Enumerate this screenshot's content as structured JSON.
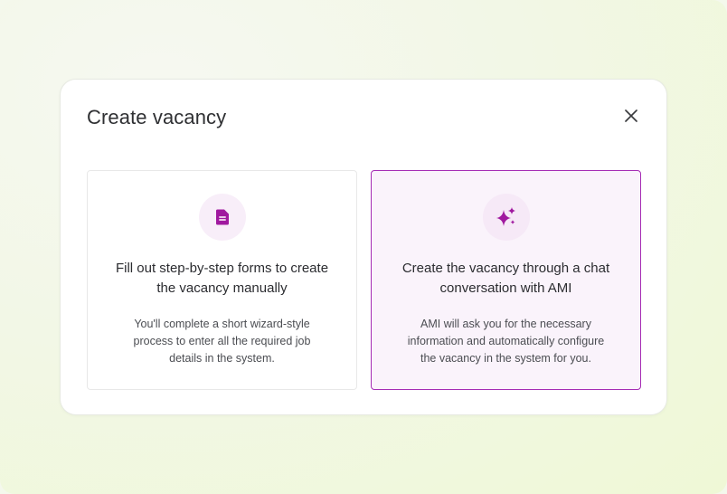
{
  "dialog": {
    "title": "Create vacancy"
  },
  "options": [
    {
      "icon": "document-icon",
      "heading": "Fill out step-by-step forms to create the vacancy manually",
      "description": "You'll complete a short wizard-style process to enter all the required job details in the system.",
      "selected": false
    },
    {
      "icon": "sparkles-icon",
      "heading": "Create the vacancy through a chat conversation with AMI",
      "description": "AMI will ask you for the necessary information and automatically configure the vacancy in the system for you.",
      "selected": true
    }
  ],
  "colors": {
    "accent": "#a0199f",
    "selected_border": "#a52cb4",
    "selected_background": "#faf3fb",
    "icon_circle": "#f8eef9"
  }
}
